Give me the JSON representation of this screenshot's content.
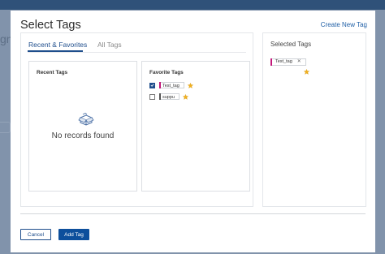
{
  "modal": {
    "title": "Select Tags",
    "create_link": "Create New Tag"
  },
  "tabs": [
    {
      "label": "Recent & Favorites",
      "active": true
    },
    {
      "label": "All Tags",
      "active": false
    }
  ],
  "recent": {
    "title": "Recent Tags",
    "empty_text": "No records found"
  },
  "favorites": {
    "title": "Favorite Tags",
    "items": [
      {
        "label": "Test_tag",
        "checked": true,
        "color": "#c2187a",
        "starred": true
      },
      {
        "label": "suppu",
        "checked": false,
        "color": "#555555",
        "starred": true
      }
    ]
  },
  "selected": {
    "title": "Selected Tags",
    "items": [
      {
        "label": "Test_tag",
        "color": "#c2187a",
        "starred": true
      }
    ]
  },
  "buttons": {
    "cancel": "Cancel",
    "add": "Add Tag"
  },
  "colors": {
    "primary": "#0d4f9c",
    "star": "#f2b01e",
    "tag_accent": "#c2187a"
  }
}
